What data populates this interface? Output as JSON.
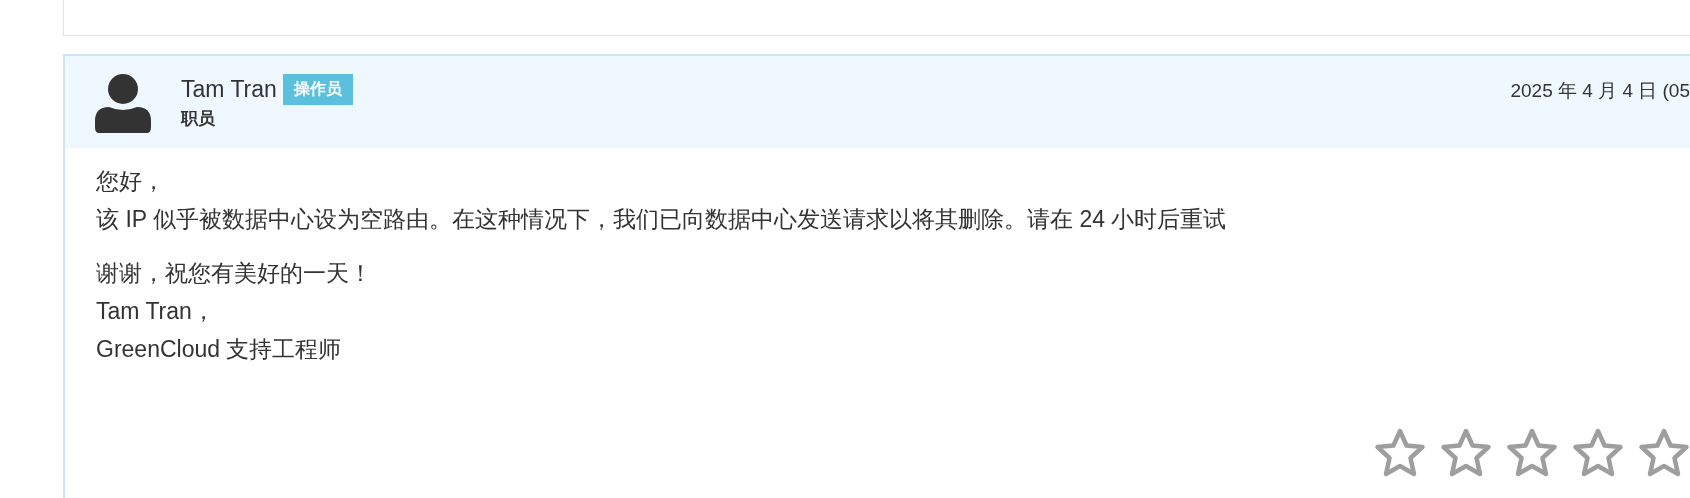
{
  "reply": {
    "author": "Tam Tran",
    "badge": "操作员",
    "role": "职员",
    "date": "2025 年 4 月 4 日 (05",
    "paragraphs": [
      [
        "您好，",
        "该 IP 似乎被数据中心设为空路由。在这种情况下，我们已向数据中心发送请求以将其删除。请在 24 小时后重试"
      ],
      [
        "谢谢，祝您有美好的一天！",
        "Tam Tran，",
        "GreenCloud 支持工程师"
      ]
    ],
    "stars": 0
  }
}
